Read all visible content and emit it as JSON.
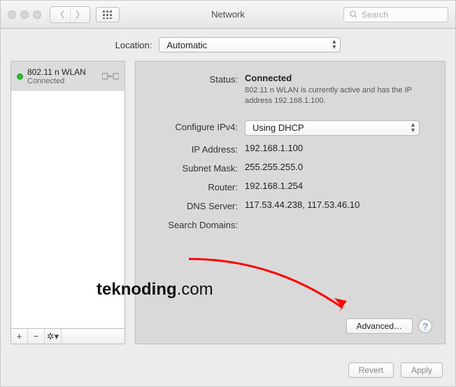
{
  "window": {
    "title": "Network"
  },
  "search": {
    "placeholder": "Search"
  },
  "location": {
    "label": "Location:",
    "value": "Automatic"
  },
  "sidebar": {
    "services": [
      {
        "name": "802.11 n WLAN",
        "status": "Connected"
      }
    ]
  },
  "detail": {
    "status_label": "Status:",
    "status_value": "Connected",
    "status_desc": "802.11 n WLAN is currently active and has the IP address 192.168.1.100.",
    "config_label": "Configure IPv4:",
    "config_value": "Using DHCP",
    "ip_label": "IP Address:",
    "ip_value": "192.168.1.100",
    "mask_label": "Subnet Mask:",
    "mask_value": "255.255.255.0",
    "router_label": "Router:",
    "router_value": "192.168.1.254",
    "dns_label": "DNS Server:",
    "dns_value": "117.53.44.238, 117.53.46.10",
    "search_label": "Search Domains:",
    "search_value": ""
  },
  "buttons": {
    "advanced": "Advanced…",
    "revert": "Revert",
    "apply": "Apply"
  },
  "overlay": {
    "brand_bold": "teknoding",
    "brand_rest": ".com"
  }
}
